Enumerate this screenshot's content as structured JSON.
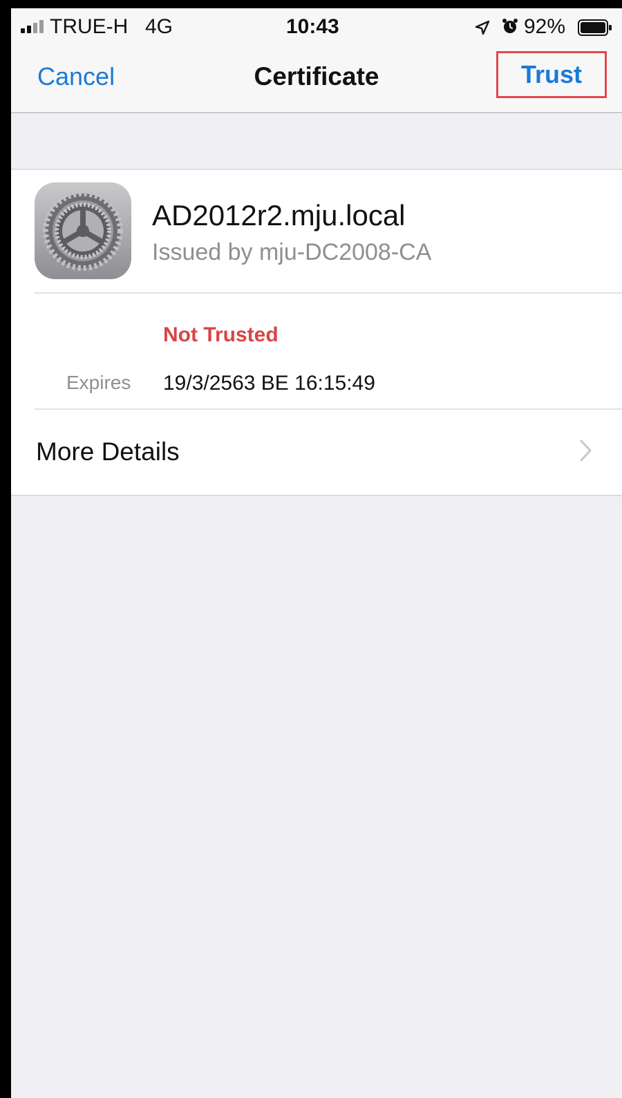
{
  "status_bar": {
    "carrier": "TRUE-H",
    "network": "4G",
    "time": "10:43",
    "battery_percent": "92%",
    "icons": [
      "signal-icon",
      "location-arrow-icon",
      "alarm-icon",
      "battery-icon"
    ],
    "signal_bars": 4,
    "signal_bars_filled": 2,
    "battery_level": 0.92
  },
  "nav": {
    "cancel_label": "Cancel",
    "title": "Certificate",
    "trust_label": "Trust"
  },
  "certificate": {
    "icon": "settings-gear-icon",
    "name": "AD2012r2.mju.local",
    "issuer": "Issued by mju-DC2008-CA",
    "trust_status": "Not Trusted",
    "expires_label": "Expires",
    "expires_value": "19/3/2563 BE 16:15:49"
  },
  "more_details": {
    "label": "More Details",
    "icon": "chevron-right-icon"
  },
  "colors": {
    "accent": "#1a7ad6",
    "not_trusted": "#d84545",
    "highlight_box": "#e0474c",
    "background": "#efeff4"
  }
}
